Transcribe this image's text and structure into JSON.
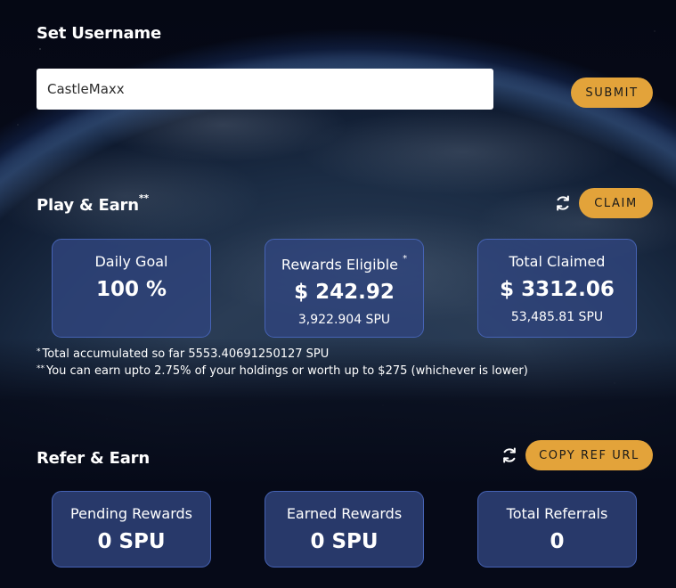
{
  "username": {
    "title": "Set Username",
    "input_value": "CastleMaxx",
    "submit_label": "SUBMIT"
  },
  "play": {
    "title": "Play & Earn",
    "title_mark": "**",
    "claim_label": "CLAIM",
    "refresh_icon": "refresh-icon",
    "cards": [
      {
        "label": "Daily Goal",
        "label_mark": "",
        "value": "100 %",
        "sub": ""
      },
      {
        "label": "Rewards Eligible",
        "label_mark": "*",
        "value": "$ 242.92",
        "sub": "3,922.904 SPU"
      },
      {
        "label": "Total Claimed",
        "label_mark": "",
        "value": "$ 3312.06",
        "sub": "53,485.81 SPU"
      }
    ],
    "footnotes": [
      {
        "mark": "*",
        "text": "Total accumulated so far 5553.40691250127 SPU"
      },
      {
        "mark": "**",
        "text": "You can earn upto 2.75% of your holdings or worth up to $275 (whichever is lower)"
      }
    ]
  },
  "refer": {
    "title": "Refer & Earn",
    "copy_label": "COPY REF URL",
    "refresh_icon": "refresh-icon",
    "cards": [
      {
        "label": "Pending Rewards",
        "value": "0 SPU"
      },
      {
        "label": "Earned Rewards",
        "value": "0 SPU"
      },
      {
        "label": "Total Referrals",
        "value": "0"
      }
    ]
  },
  "colors": {
    "accent": "#e3a33a",
    "card_bg": "#30447c",
    "card_border": "#4663b5"
  }
}
